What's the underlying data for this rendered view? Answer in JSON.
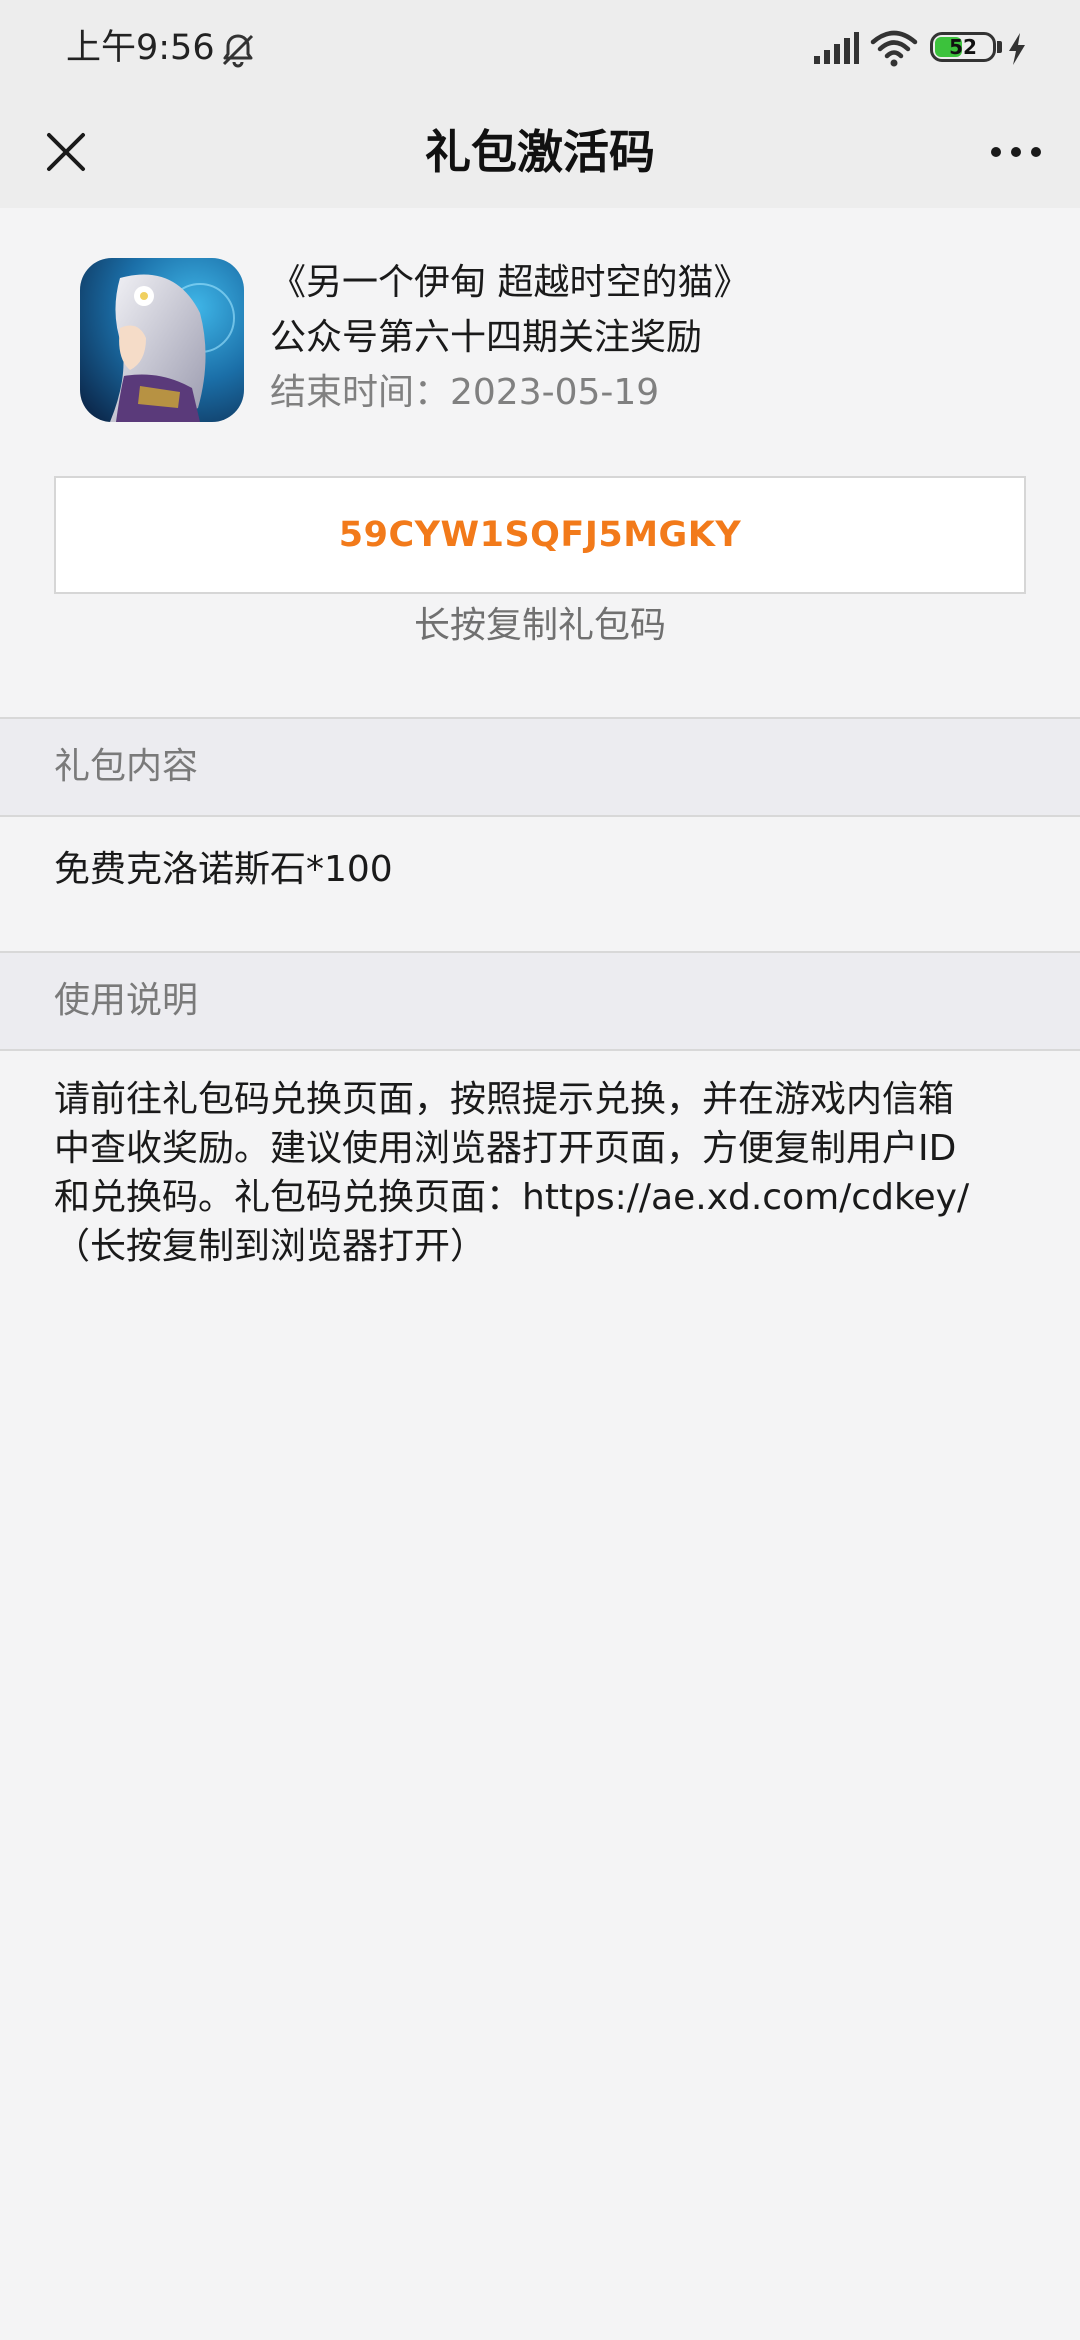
{
  "status_bar": {
    "time": "上午9:56",
    "battery_level": "52",
    "battery_fraction": 0.52,
    "icons": [
      "notifications-off-icon",
      "signal-icon",
      "wifi-icon",
      "battery-icon",
      "charging-icon"
    ]
  },
  "nav": {
    "title": "礼包激活码",
    "close_icon": "close-icon",
    "more_icon": "more-icon"
  },
  "gift": {
    "game_title": "《另一个伊甸 超越时空的猫》",
    "subtitle": "公众号第六十四期关注奖励",
    "end_time": "结束时间：2023-05-19",
    "code": "59CYW1SQFJ5MGKY",
    "copy_hint": "长按复制礼包码"
  },
  "content_section": {
    "header": "礼包内容",
    "text": "免费克洛诺斯石*100"
  },
  "usage_section": {
    "header": "使用说明",
    "lines": [
      "请前往礼包码兑换页面，按照提示兑换，并在游戏内信箱",
      "中查收奖励。建议使用浏览器打开页面，方便复制用户ID",
      "和兑换码。礼包码兑换页面：https://ae.xd.com/cdkey/",
      "（长按复制到浏览器打开）"
    ]
  },
  "colors": {
    "accent": "#f27a1a",
    "bar_bg": "#ededed",
    "page_bg": "#f4f4f5",
    "section_header_bg": "#ececf0"
  }
}
